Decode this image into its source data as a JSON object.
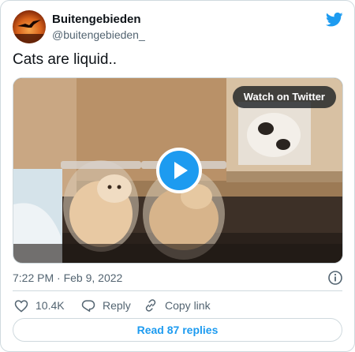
{
  "author": {
    "name": "Buitengebieden",
    "handle": "@buitengebieden_"
  },
  "tweet": {
    "text": "Cats are liquid.."
  },
  "media": {
    "watch_label": "Watch on Twitter"
  },
  "meta": {
    "timestamp": "7:22 PM · Feb 9, 2022"
  },
  "actions": {
    "likes": "10.4K",
    "reply_label": "Reply",
    "copy_link_label": "Copy link"
  },
  "read_replies_label": "Read 87 replies",
  "colors": {
    "brand": "#1d9bf0",
    "text": "#0f1419",
    "muted": "#536471",
    "border": "#cfd9de"
  },
  "icons": [
    "twitter-bird-icon",
    "play-icon",
    "info-icon",
    "heart-icon",
    "reply-icon",
    "link-icon"
  ]
}
